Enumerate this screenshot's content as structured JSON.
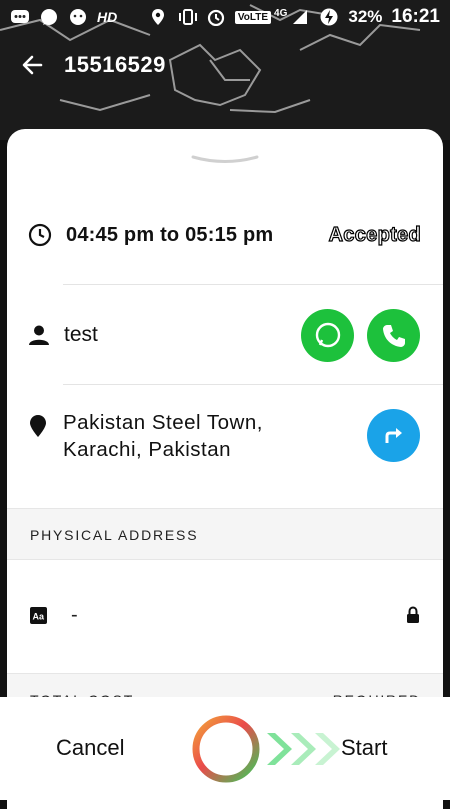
{
  "status_bar": {
    "hd_label": "HD",
    "volte_label": "VoLTE",
    "network_label": "4G",
    "battery_percent": "32%",
    "time": "16:21"
  },
  "app_bar": {
    "title": "15516529"
  },
  "booking": {
    "time_range": "04:45 pm to 05:15 pm",
    "status": "Accepted",
    "customer_name": "test",
    "address_line1": "Pakistan Steel Town,",
    "address_line2": "Karachi, Pakistan"
  },
  "physical_address": {
    "header": "PHYSICAL ADDRESS",
    "value": "-"
  },
  "cost_section": {
    "header": "TOTAL COST",
    "required": "REQUIRED"
  },
  "actions": {
    "cancel_label": "Cancel",
    "start_label": "Start"
  },
  "colors": {
    "accent_green": "#1DC13C",
    "direction_blue": "#1AA3E8",
    "chevron_green": "#7FE29A"
  }
}
